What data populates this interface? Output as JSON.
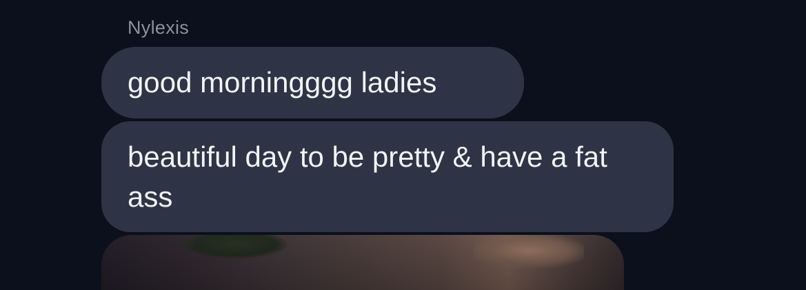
{
  "message_group": {
    "sender_name": "Nylexis",
    "messages": [
      {
        "text": "good morningggg ladies"
      },
      {
        "text": "beautiful day to be pretty & have a fat ass"
      }
    ],
    "attachment": {
      "kind": "photo"
    }
  },
  "colors": {
    "background": "#0c0f1c",
    "bubble": "#2e3446",
    "bubble_text": "#f2f3f7",
    "sender_name": "#8d909e"
  }
}
